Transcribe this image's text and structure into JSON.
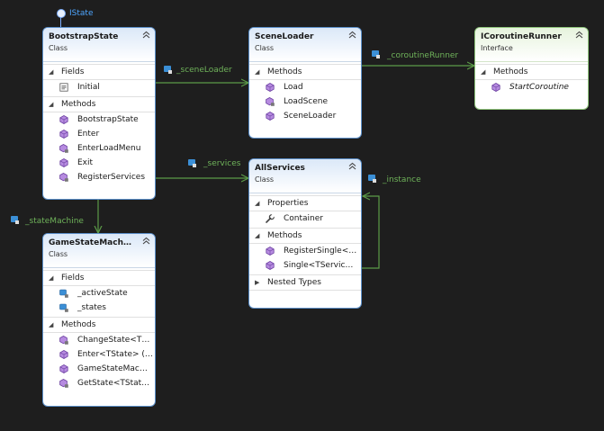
{
  "lollipop": {
    "label": "IState"
  },
  "boxes": {
    "bootstrap": {
      "title": "BootstrapState",
      "stereotype": "Class",
      "sections": [
        {
          "label": "Fields",
          "items": [
            {
              "label": "Initial",
              "icon": "constant-field-icon"
            }
          ]
        },
        {
          "label": "Methods",
          "items": [
            {
              "label": "BootstrapState",
              "icon": "method-icon"
            },
            {
              "label": "Enter",
              "icon": "method-icon"
            },
            {
              "label": "EnterLoadMenu",
              "icon": "private-method-icon"
            },
            {
              "label": "Exit",
              "icon": "method-icon"
            },
            {
              "label": "RegisterServices",
              "icon": "private-method-icon"
            }
          ]
        }
      ]
    },
    "sceneLoader": {
      "title": "SceneLoader",
      "stereotype": "Class",
      "sections": [
        {
          "label": "Methods",
          "items": [
            {
              "label": "Load",
              "icon": "method-icon"
            },
            {
              "label": "LoadScene",
              "icon": "private-method-icon"
            },
            {
              "label": "SceneLoader",
              "icon": "method-icon"
            }
          ]
        }
      ]
    },
    "coroutineRunner": {
      "title": "ICoroutineRunner",
      "stereotype": "Interface",
      "sections": [
        {
          "label": "Methods",
          "items": [
            {
              "label": "StartCoroutine",
              "icon": "method-icon",
              "italic": true
            }
          ]
        }
      ]
    },
    "allServices": {
      "title": "AllServices",
      "stereotype": "Class",
      "sections": [
        {
          "label": "Properties",
          "items": [
            {
              "label": "Container",
              "icon": "wrench-icon"
            }
          ]
        },
        {
          "label": "Methods",
          "items": [
            {
              "label": "RegisterSingle<…",
              "icon": "method-icon"
            },
            {
              "label": "Single<TServic…",
              "icon": "method-icon"
            }
          ]
        },
        {
          "label": "Nested Types",
          "items": [],
          "collapsed": true
        }
      ]
    },
    "gameStateMachine": {
      "title": "GameStateMach…",
      "stereotype": "Class",
      "sections": [
        {
          "label": "Fields",
          "items": [
            {
              "label": "_activeState",
              "icon": "private-field-icon"
            },
            {
              "label": "_states",
              "icon": "private-field-icon"
            }
          ]
        },
        {
          "label": "Methods",
          "items": [
            {
              "label": "ChangeState<T…",
              "icon": "private-method-icon"
            },
            {
              "label": "Enter<TState>  (…",
              "icon": "method-icon"
            },
            {
              "label": "GameStateMac…",
              "icon": "method-icon"
            },
            {
              "label": "GetState<TStat…",
              "icon": "private-method-icon"
            }
          ]
        }
      ]
    }
  },
  "links": {
    "sceneLoader": "_sceneLoader",
    "coroutineRunner": "_coroutineRunner",
    "services": "_services",
    "instance": "_instance",
    "stateMachine": "_stateMachine"
  },
  "colors": {
    "background": "#1e1e1e",
    "classBorder": "#5b8fc9",
    "interfaceBorder": "#8ec47a",
    "association": "#5c9b48",
    "linkLabel": "#6fb35a",
    "lollipop": "#4ea6ff"
  }
}
